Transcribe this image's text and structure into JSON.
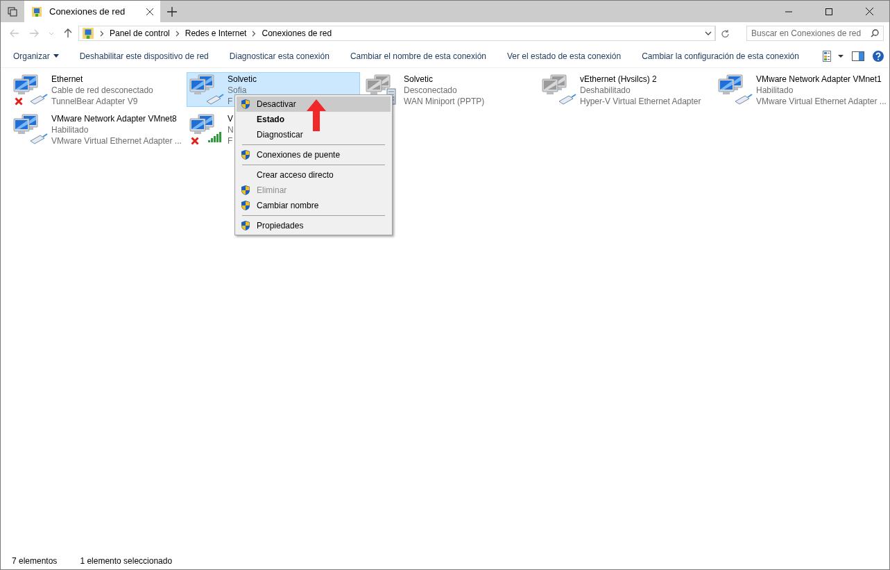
{
  "window": {
    "tab_title": "Conexiones de red"
  },
  "address": {
    "path": [
      "Panel de control",
      "Redes e Internet",
      "Conexiones de red"
    ]
  },
  "search": {
    "placeholder": "Buscar en Conexiones de red"
  },
  "toolbar": [
    {
      "label": "Organizar",
      "dropdown": true
    },
    {
      "label": "Deshabilitar este dispositivo de red",
      "dropdown": false
    },
    {
      "label": "Diagnosticar esta conexión",
      "dropdown": false
    },
    {
      "label": "Cambiar el nombre de esta conexión",
      "dropdown": false
    },
    {
      "label": "Ver el estado de esta conexión",
      "dropdown": false
    },
    {
      "label": "Cambiar la configuración de esta conexión",
      "dropdown": false
    }
  ],
  "connections": [
    {
      "name": "Ethernet",
      "status": "Cable de red desconectado",
      "device": "TunnelBear Adapter V9",
      "kind": "ethernet",
      "enabled": true,
      "disconnected": true,
      "selected": false
    },
    {
      "name": "Solvetic",
      "status": "Sofia",
      "device": "F",
      "kind": "ethernet",
      "enabled": true,
      "disconnected": false,
      "selected": true
    },
    {
      "name": "Solvetic",
      "status": "Desconectado",
      "device": "WAN Miniport (PPTP)",
      "kind": "wan",
      "enabled": false,
      "disconnected": false,
      "selected": false
    },
    {
      "name": "vEthernet (Hvsilcs) 2",
      "status": "Deshabilitado",
      "device": "Hyper-V Virtual Ethernet Adapter",
      "kind": "ethernet",
      "enabled": false,
      "disconnected": false,
      "selected": false
    },
    {
      "name": "VMware Network Adapter VMnet1",
      "status": "Habilitado",
      "device": "VMware Virtual Ethernet Adapter ...",
      "kind": "ethernet",
      "enabled": true,
      "disconnected": false,
      "selected": false
    },
    {
      "name": "VMware Network Adapter VMnet8",
      "status": "Habilitado",
      "device": "VMware Virtual Ethernet Adapter ...",
      "kind": "ethernet",
      "enabled": true,
      "disconnected": false,
      "selected": false
    },
    {
      "name": "V",
      "status": "N",
      "device": "F",
      "kind": "wifi",
      "enabled": true,
      "disconnected": true,
      "selected": false
    }
  ],
  "context_menu": [
    {
      "kind": "item",
      "label": "Desactivar",
      "shield": true,
      "bold": false,
      "disabled": false,
      "selected": true
    },
    {
      "kind": "item",
      "label": "Estado",
      "shield": false,
      "bold": true,
      "disabled": false,
      "selected": false
    },
    {
      "kind": "item",
      "label": "Diagnosticar",
      "shield": false,
      "bold": false,
      "disabled": false,
      "selected": false
    },
    {
      "kind": "separator"
    },
    {
      "kind": "item",
      "label": "Conexiones de puente",
      "shield": true,
      "bold": false,
      "disabled": false,
      "selected": false
    },
    {
      "kind": "separator"
    },
    {
      "kind": "item",
      "label": "Crear acceso directo",
      "shield": false,
      "bold": false,
      "disabled": false,
      "selected": false
    },
    {
      "kind": "item",
      "label": "Eliminar",
      "shield": true,
      "bold": false,
      "disabled": true,
      "selected": false
    },
    {
      "kind": "item",
      "label": "Cambiar nombre",
      "shield": true,
      "bold": false,
      "disabled": false,
      "selected": false
    },
    {
      "kind": "separator"
    },
    {
      "kind": "item",
      "label": "Propiedades",
      "shield": true,
      "bold": false,
      "disabled": false,
      "selected": false
    }
  ],
  "status_bar": [
    "7 elementos",
    "1 elemento seleccionado"
  ]
}
